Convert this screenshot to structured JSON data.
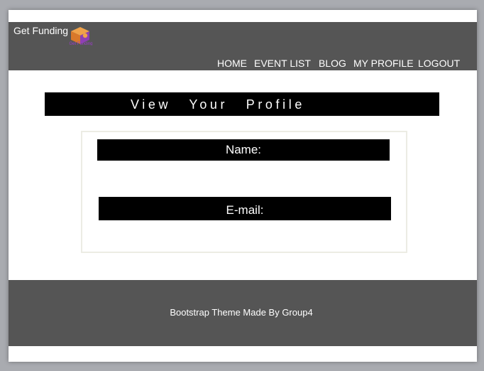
{
  "navbar": {
    "brand": "Get Funding",
    "logo_caption": "Get Funding",
    "links": [
      {
        "label": "HOME"
      },
      {
        "label": "EVENT LIST"
      },
      {
        "label": "BLOG"
      },
      {
        "label": "MY PROFILE"
      },
      {
        "label": "LOGOUT"
      }
    ]
  },
  "main": {
    "title": "View Your Profile",
    "fields": {
      "name_label": "Name:",
      "email_label": "E-mail:"
    }
  },
  "footer": {
    "text": "Bootstrap Theme Made By Group4"
  },
  "colors": {
    "navbar_bg": "#555555",
    "title_bar_bg": "#000000",
    "logo_orange": "#e58a2f",
    "logo_purple": "#8e3fb5"
  }
}
